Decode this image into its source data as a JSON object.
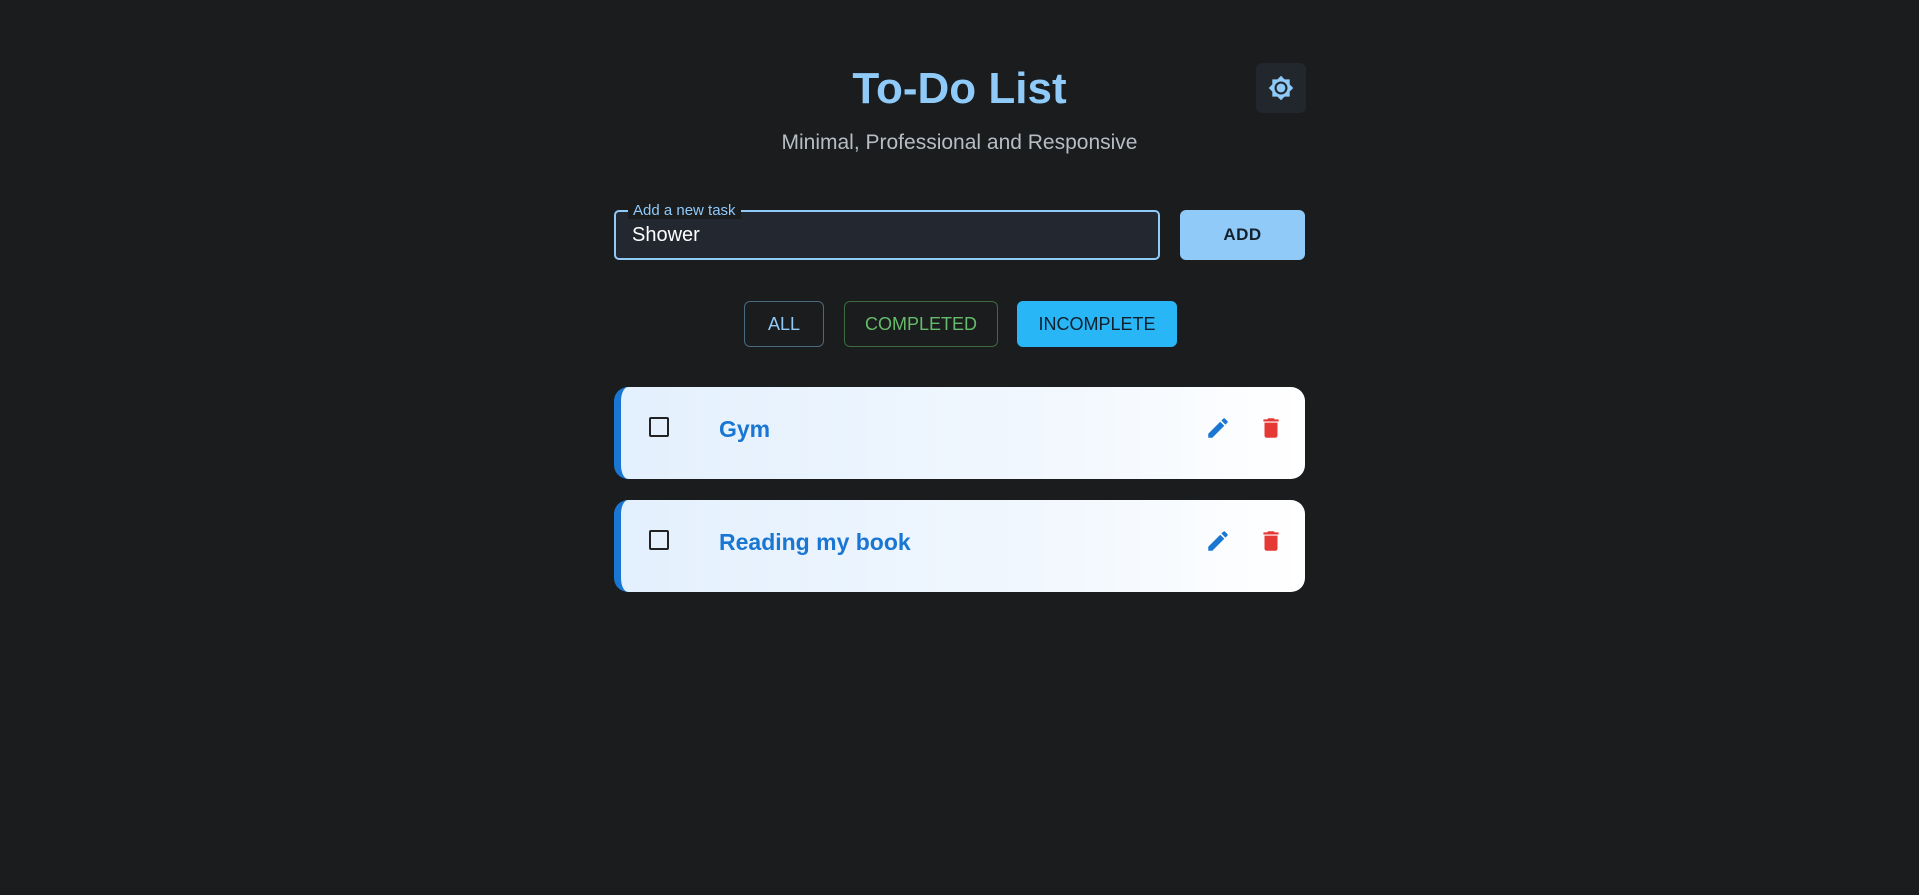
{
  "header": {
    "title": "To-Do List",
    "subtitle": "Minimal, Professional and Responsive",
    "theme_toggle_icon": "brightness-icon"
  },
  "add_task": {
    "label": "Add a new task",
    "value": "Shower",
    "button_label": "ADD"
  },
  "filters": [
    {
      "label": "ALL",
      "active": false,
      "color": "#90caf9"
    },
    {
      "label": "COMPLETED",
      "active": false,
      "color": "#66bb6a"
    },
    {
      "label": "INCOMPLETE",
      "active": true,
      "color": "#29b6f6"
    }
  ],
  "tasks": [
    {
      "text": "Gym",
      "completed": false,
      "edit_icon": "pencil-icon",
      "delete_icon": "trash-icon"
    },
    {
      "text": "Reading my book",
      "completed": false,
      "edit_icon": "pencil-icon",
      "delete_icon": "trash-icon"
    }
  ],
  "colors": {
    "background": "#1a1c1e",
    "accent": "#90caf9",
    "task_accent": "#1976d2",
    "delete": "#e53935"
  }
}
